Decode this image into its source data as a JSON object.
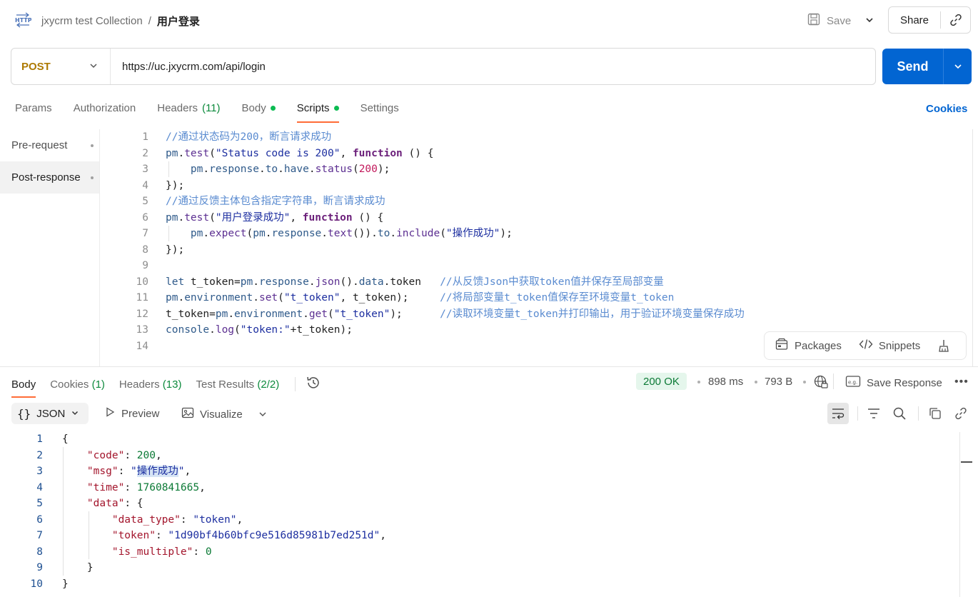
{
  "header": {
    "collection": "jxycrm test Collection",
    "separator": "/",
    "request_name": "用户登录",
    "save_label": "Save",
    "share_label": "Share",
    "http_icon_text": "HTTP"
  },
  "request": {
    "method": "POST",
    "url": "https://uc.jxycrm.com/api/login",
    "send_label": "Send"
  },
  "tabs": {
    "params": "Params",
    "authorization": "Authorization",
    "headers": "Headers",
    "headers_count": "(11)",
    "body": "Body",
    "scripts": "Scripts",
    "settings": "Settings",
    "cookies": "Cookies"
  },
  "scripts_sidebar": {
    "pre_request": "Pre-request",
    "post_response": "Post-response"
  },
  "editor": {
    "line_numbers": [
      "1",
      "2",
      "3",
      "4",
      "5",
      "6",
      "7",
      "8",
      "9",
      "10",
      "11",
      "12",
      "13",
      "14"
    ],
    "lines": [
      [
        [
          "cm",
          "//通过状态码为200，断言请求成功"
        ]
      ],
      [
        [
          "id",
          "pm"
        ],
        [
          "pl",
          "."
        ],
        [
          "fn",
          "test"
        ],
        [
          "pl",
          "("
        ],
        [
          "str",
          "\"Status code is 200\""
        ],
        [
          "pl",
          ", "
        ],
        [
          "kw",
          "function"
        ],
        [
          "pl",
          " () {"
        ]
      ],
      [
        [
          "pl",
          "    "
        ],
        [
          "id",
          "pm"
        ],
        [
          "pl",
          "."
        ],
        [
          "id",
          "response"
        ],
        [
          "pl",
          "."
        ],
        [
          "id",
          "to"
        ],
        [
          "pl",
          "."
        ],
        [
          "id",
          "have"
        ],
        [
          "pl",
          "."
        ],
        [
          "fn",
          "status"
        ],
        [
          "pl",
          "("
        ],
        [
          "num",
          "200"
        ],
        [
          "pl",
          ");"
        ]
      ],
      [
        [
          "pl",
          "});"
        ]
      ],
      [
        [
          "cm",
          "//通过反馈主体包含指定字符串，断言请求成功"
        ]
      ],
      [
        [
          "id",
          "pm"
        ],
        [
          "pl",
          "."
        ],
        [
          "fn",
          "test"
        ],
        [
          "pl",
          "("
        ],
        [
          "str",
          "\"用户登录成功\""
        ],
        [
          "pl",
          ", "
        ],
        [
          "kw",
          "function"
        ],
        [
          "pl",
          " () {"
        ]
      ],
      [
        [
          "pl",
          "    "
        ],
        [
          "id",
          "pm"
        ],
        [
          "pl",
          "."
        ],
        [
          "fn",
          "expect"
        ],
        [
          "pl",
          "("
        ],
        [
          "id",
          "pm"
        ],
        [
          "pl",
          "."
        ],
        [
          "id",
          "response"
        ],
        [
          "pl",
          "."
        ],
        [
          "fn",
          "text"
        ],
        [
          "pl",
          "())."
        ],
        [
          "id",
          "to"
        ],
        [
          "pl",
          "."
        ],
        [
          "fn",
          "include"
        ],
        [
          "pl",
          "("
        ],
        [
          "str",
          "\"操作成功\""
        ],
        [
          "pl",
          ");"
        ]
      ],
      [
        [
          "pl",
          "});"
        ]
      ],
      [],
      [
        [
          "id",
          "let"
        ],
        [
          "pl",
          " t_token="
        ],
        [
          "id",
          "pm"
        ],
        [
          "pl",
          "."
        ],
        [
          "id",
          "response"
        ],
        [
          "pl",
          "."
        ],
        [
          "fn",
          "json"
        ],
        [
          "pl",
          "()."
        ],
        [
          "id",
          "data"
        ],
        [
          "pl",
          "."
        ],
        [
          "pl",
          "token   "
        ],
        [
          "cm",
          "//从反馈Json中获取token值并保存至局部变量"
        ]
      ],
      [
        [
          "id",
          "pm"
        ],
        [
          "pl",
          "."
        ],
        [
          "id",
          "environment"
        ],
        [
          "pl",
          "."
        ],
        [
          "fn",
          "set"
        ],
        [
          "pl",
          "("
        ],
        [
          "str",
          "\"t_token\""
        ],
        [
          "pl",
          ", t_token);     "
        ],
        [
          "cm",
          "//将局部变量t_token值保存至环境变量t_token"
        ]
      ],
      [
        [
          "pl",
          "t_token="
        ],
        [
          "id",
          "pm"
        ],
        [
          "pl",
          "."
        ],
        [
          "id",
          "environment"
        ],
        [
          "pl",
          "."
        ],
        [
          "fn",
          "get"
        ],
        [
          "pl",
          "("
        ],
        [
          "str",
          "\"t_token\""
        ],
        [
          "pl",
          ");      "
        ],
        [
          "cm",
          "//读取环境变量t_token并打印输出，用于验证环境变量保存成功"
        ]
      ],
      [
        [
          "id",
          "console"
        ],
        [
          "pl",
          "."
        ],
        [
          "fn",
          "log"
        ],
        [
          "pl",
          "("
        ],
        [
          "str",
          "\"token:\""
        ],
        [
          "pl",
          "+t_token);"
        ]
      ],
      []
    ]
  },
  "editor_tools": {
    "packages": "Packages",
    "snippets": "Snippets"
  },
  "response": {
    "tabs": {
      "body": "Body",
      "cookies": "Cookies",
      "cookies_count": "(1)",
      "headers": "Headers",
      "headers_count": "(13)",
      "test_results": "Test Results",
      "test_results_count": "(2/2)"
    },
    "status": "200 OK",
    "time": "898 ms",
    "size": "793 B",
    "save_response": "Save Response",
    "format": "JSON",
    "preview": "Preview",
    "visualize": "Visualize",
    "line_numbers": [
      "1",
      "2",
      "3",
      "4",
      "5",
      "6",
      "7",
      "8",
      "9",
      "10"
    ],
    "body_lines": [
      [
        [
          "pl",
          "{"
        ]
      ],
      [
        [
          "pl",
          "    "
        ],
        [
          "key",
          "\"code\""
        ],
        [
          "pl",
          ": "
        ],
        [
          "num",
          "200"
        ],
        [
          "pl",
          ","
        ]
      ],
      [
        [
          "pl",
          "    "
        ],
        [
          "key",
          "\"msg\""
        ],
        [
          "pl",
          ": "
        ],
        [
          "str",
          "\""
        ],
        [
          "hl",
          "操作成功"
        ],
        [
          "str",
          "\""
        ],
        [
          "pl",
          ","
        ]
      ],
      [
        [
          "pl",
          "    "
        ],
        [
          "key",
          "\"time\""
        ],
        [
          "pl",
          ": "
        ],
        [
          "num",
          "1760841665"
        ],
        [
          "pl",
          ","
        ]
      ],
      [
        [
          "pl",
          "    "
        ],
        [
          "key",
          "\"data\""
        ],
        [
          "pl",
          ": {"
        ]
      ],
      [
        [
          "pl",
          "        "
        ],
        [
          "key",
          "\"data_type\""
        ],
        [
          "pl",
          ": "
        ],
        [
          "str",
          "\"token\""
        ],
        [
          "pl",
          ","
        ]
      ],
      [
        [
          "pl",
          "        "
        ],
        [
          "key",
          "\"token\""
        ],
        [
          "pl",
          ": "
        ],
        [
          "str",
          "\"1d90bf4b60bfc9e516d85981b7ed251d\""
        ],
        [
          "pl",
          ","
        ]
      ],
      [
        [
          "pl",
          "        "
        ],
        [
          "key",
          "\"is_multiple\""
        ],
        [
          "pl",
          ": "
        ],
        [
          "num",
          "0"
        ]
      ],
      [
        [
          "pl",
          "    }"
        ]
      ],
      [
        [
          "pl",
          "}"
        ]
      ]
    ]
  },
  "colors": {
    "accent_orange": "#ff6c37",
    "send_blue": "#0265d2",
    "method_post": "#ad7a03",
    "status_green": "#0c7a36"
  }
}
